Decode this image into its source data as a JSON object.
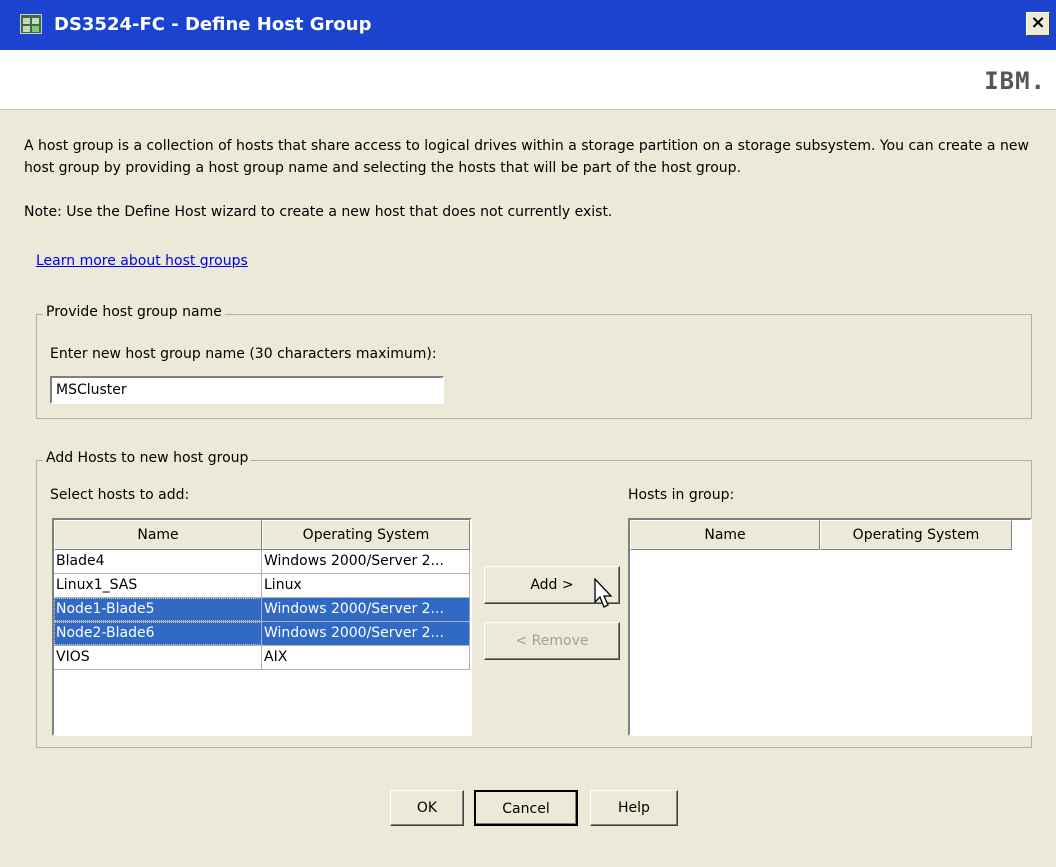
{
  "window": {
    "title": "DS3524-FC - Define Host Group",
    "close_glyph": "×"
  },
  "brand": {
    "logo": "IBM."
  },
  "intro": {
    "description": "A host group is a collection of hosts that share access to logical drives within a storage partition on a storage subsystem. You can create a new host group by providing a host group name and selecting the hosts that will be part of the host group.",
    "note": "Note: Use the Define Host wizard to create a new host that does not currently exist.",
    "learn_more": "Learn more about host groups"
  },
  "name_section": {
    "legend": "Provide host group name",
    "prompt": "Enter new host group name (30 characters maximum):",
    "value": "MSCluster"
  },
  "hosts_section": {
    "legend": "Add Hosts to new host group",
    "select_label": "Select hosts to add:",
    "group_label": "Hosts in group:",
    "columns": [
      "Name",
      "Operating System"
    ],
    "available_hosts": [
      {
        "name": "Blade4",
        "os": "Windows 2000/Server 2...",
        "selected": false
      },
      {
        "name": "Linux1_SAS",
        "os": "Linux",
        "selected": false
      },
      {
        "name": "Node1-Blade5",
        "os": "Windows 2000/Server 2...",
        "selected": true
      },
      {
        "name": "Node2-Blade6",
        "os": "Windows 2000/Server 2...",
        "selected": true
      },
      {
        "name": "VIOS",
        "os": "AIX",
        "selected": false
      }
    ],
    "group_hosts": [],
    "add_label": "Add >",
    "remove_label": "< Remove"
  },
  "footer": {
    "ok_label": "OK",
    "cancel_label": "Cancel",
    "help_label": "Help"
  },
  "colors": {
    "titlebar": "#1a44cf",
    "selection": "#316ac5",
    "dialog_bg": "#ece9d8"
  }
}
